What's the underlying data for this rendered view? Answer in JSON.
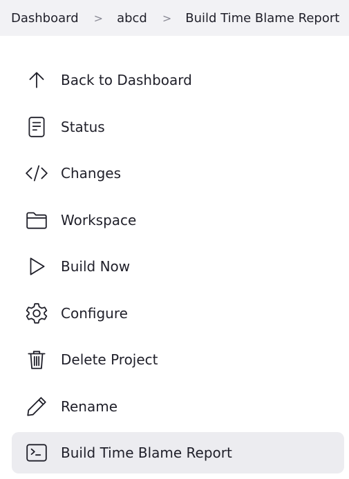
{
  "breadcrumb": {
    "items": [
      "Dashboard",
      "abcd",
      "Build Time Blame Report"
    ],
    "separator": ">"
  },
  "sidebar": {
    "items": [
      {
        "label": "Back to Dashboard",
        "icon": "arrow-up-icon"
      },
      {
        "label": "Status",
        "icon": "document-icon"
      },
      {
        "label": "Changes",
        "icon": "code-icon"
      },
      {
        "label": "Workspace",
        "icon": "folder-icon"
      },
      {
        "label": "Build Now",
        "icon": "play-icon"
      },
      {
        "label": "Configure",
        "icon": "gear-icon"
      },
      {
        "label": "Delete Project",
        "icon": "trash-icon"
      },
      {
        "label": "Rename",
        "icon": "pencil-icon"
      },
      {
        "label": "Build Time Blame Report",
        "icon": "terminal-icon",
        "active": true
      }
    ]
  },
  "colors": {
    "breadcrumb_bg": "#f2f2f5",
    "active_item_bg": "#ececf0",
    "text": "#1f1f29"
  }
}
